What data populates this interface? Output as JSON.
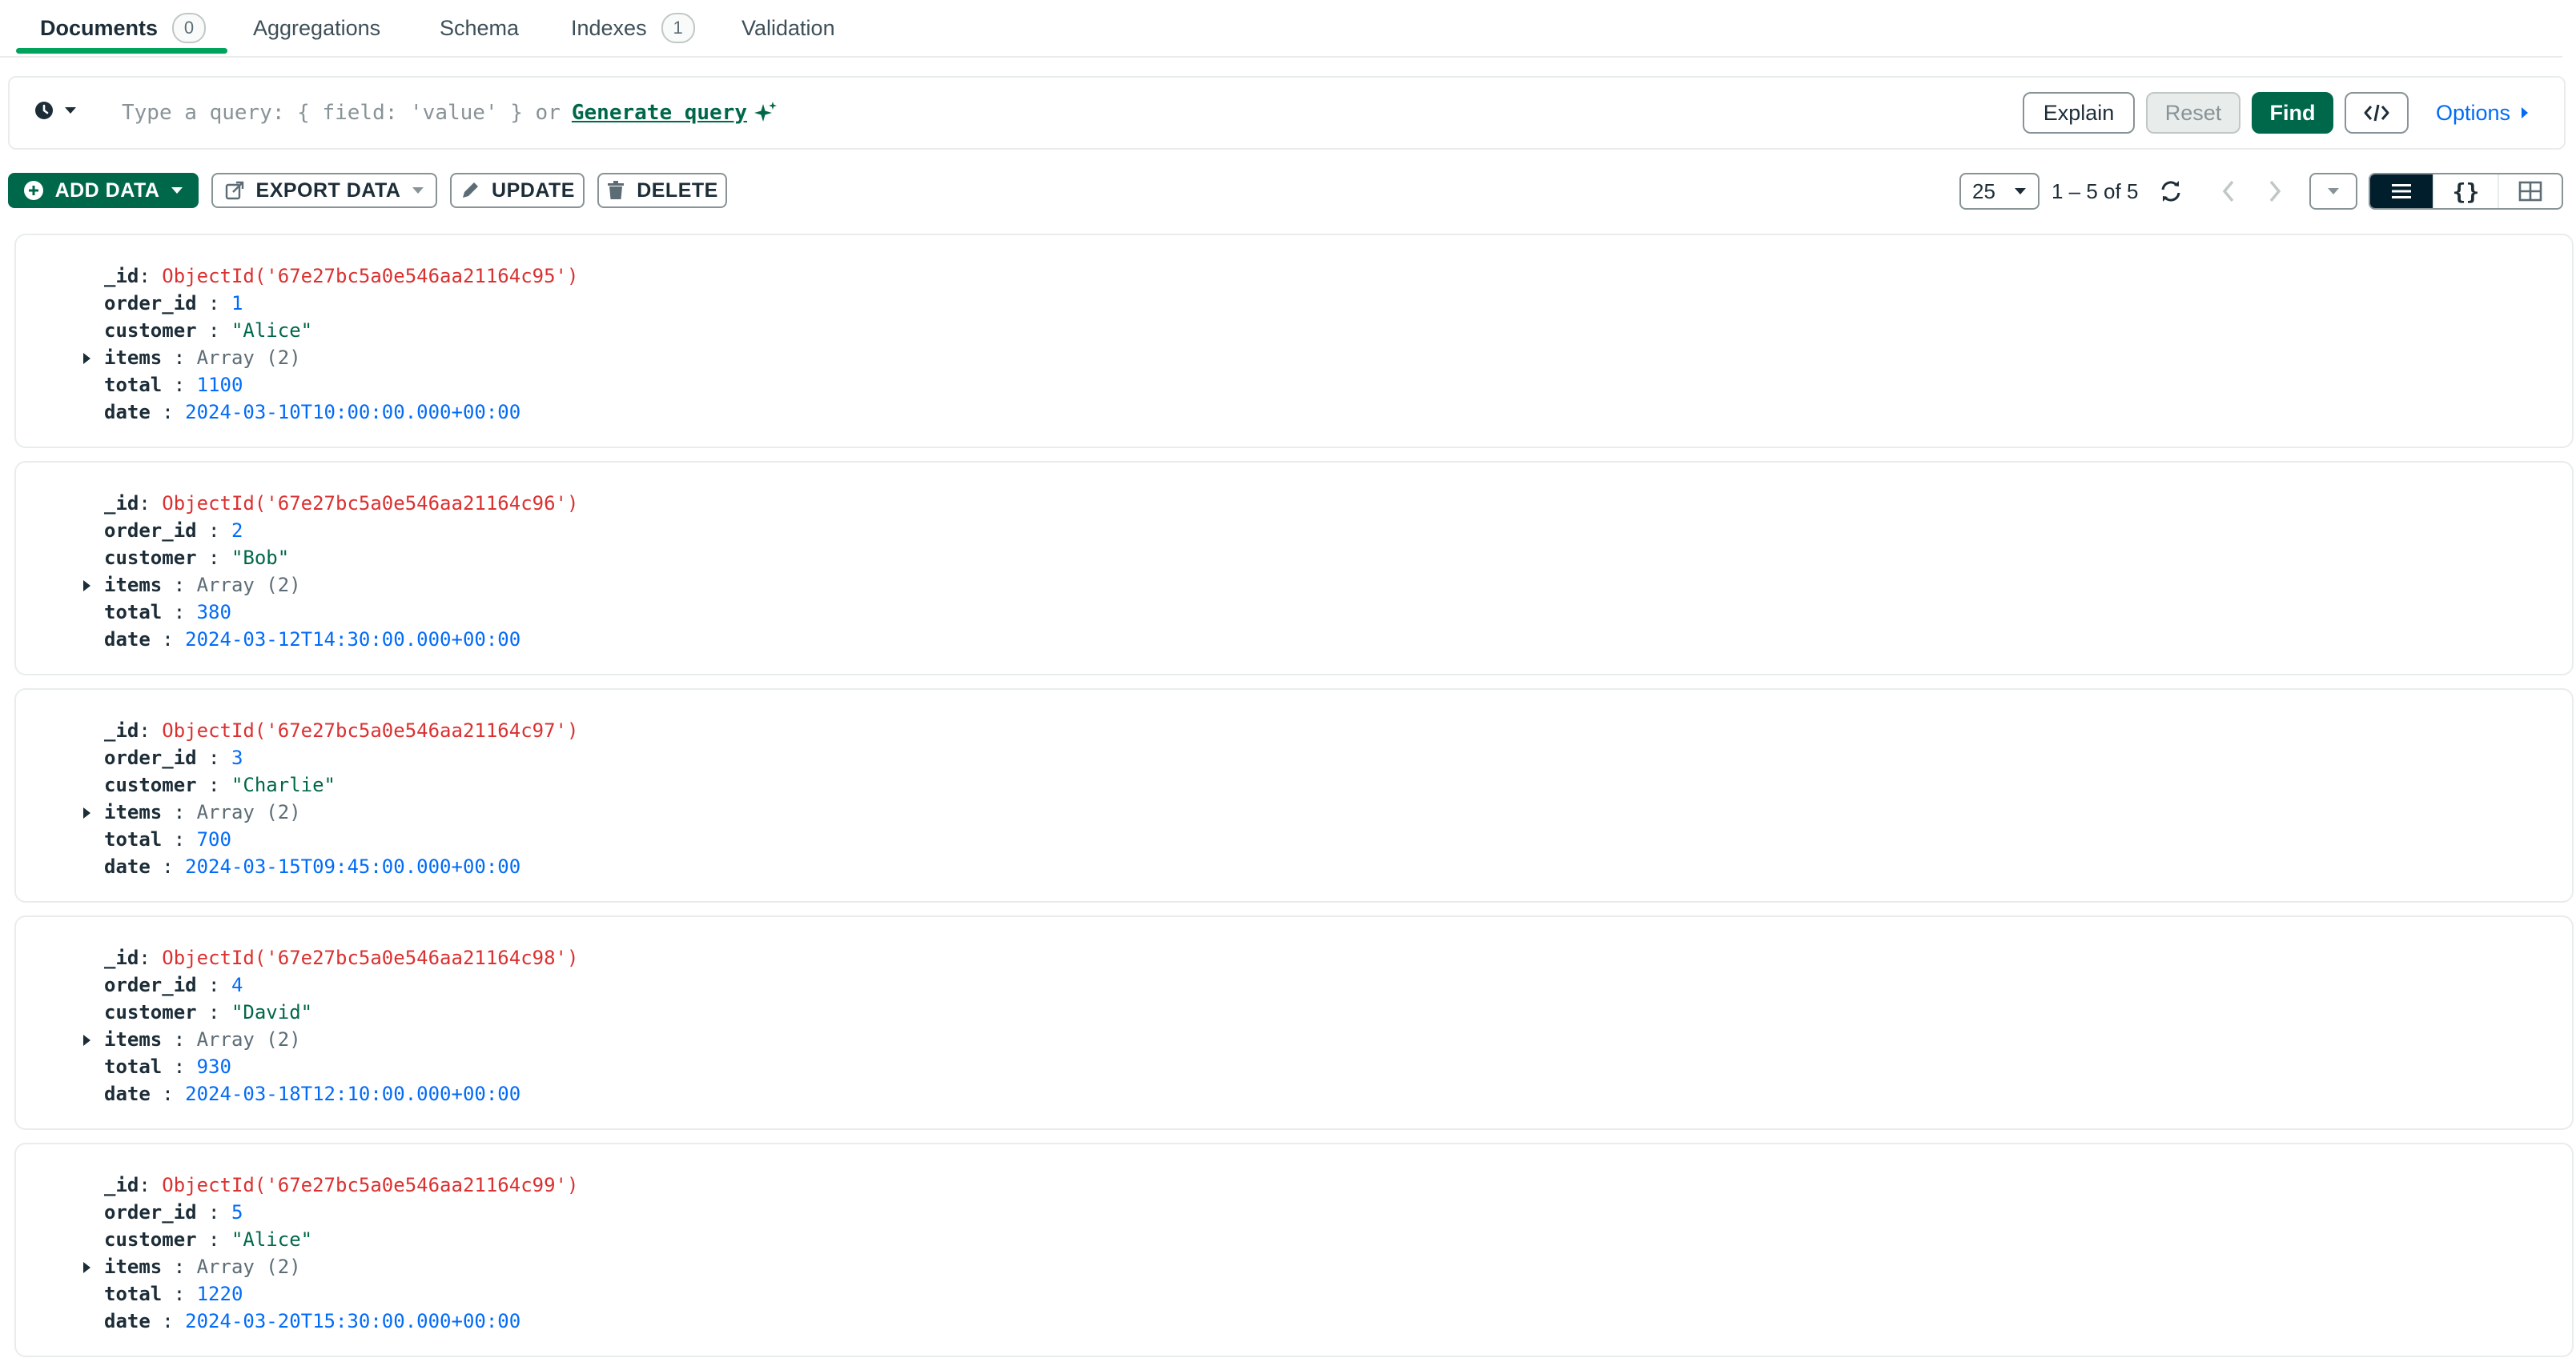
{
  "tabs": [
    {
      "label": "Documents",
      "count": "0"
    },
    {
      "label": "Aggregations"
    },
    {
      "label": "Schema"
    },
    {
      "label": "Indexes",
      "count": "1"
    },
    {
      "label": "Validation"
    }
  ],
  "query": {
    "placeholder": "Type a query: { field: 'value' } or",
    "generate_label": "Generate query",
    "explain_label": "Explain",
    "reset_label": "Reset",
    "find_label": "Find",
    "options_label": "Options"
  },
  "toolbar": {
    "add_data": "ADD DATA",
    "export_data": "EXPORT DATA",
    "update": "UPDATE",
    "delete": "DELETE",
    "page_size": "25",
    "range": "1 – 5 of 5"
  },
  "documents": [
    {
      "_id": "ObjectId('67e27bc5a0e546aa21164c95')",
      "order_id": "1",
      "customer": "\"Alice\"",
      "items": "Array (2)",
      "total": "1100",
      "date": "2024-03-10T10:00:00.000+00:00"
    },
    {
      "_id": "ObjectId('67e27bc5a0e546aa21164c96')",
      "order_id": "2",
      "customer": "\"Bob\"",
      "items": "Array (2)",
      "total": "380",
      "date": "2024-03-12T14:30:00.000+00:00"
    },
    {
      "_id": "ObjectId('67e27bc5a0e546aa21164c97')",
      "order_id": "3",
      "customer": "\"Charlie\"",
      "items": "Array (2)",
      "total": "700",
      "date": "2024-03-15T09:45:00.000+00:00"
    },
    {
      "_id": "ObjectId('67e27bc5a0e546aa21164c98')",
      "order_id": "4",
      "customer": "\"David\"",
      "items": "Array (2)",
      "total": "930",
      "date": "2024-03-18T12:10:00.000+00:00"
    },
    {
      "_id": "ObjectId('67e27bc5a0e546aa21164c99')",
      "order_id": "5",
      "customer": "\"Alice\"",
      "items": "Array (2)",
      "total": "1220",
      "date": "2024-03-20T15:30:00.000+00:00"
    }
  ],
  "field_keys": {
    "_id": "_id",
    "order_id": "order_id",
    "customer": "customer",
    "items": "items",
    "total": "total",
    "date": "date"
  },
  "colors": {
    "accent": "#00684a",
    "tab_active": "#00a35c",
    "link": "#016bf8",
    "objectid": "#db3030"
  },
  "icons": {
    "history": "clock-icon",
    "generate": "sparkle-icon",
    "code": "code-icon",
    "refresh": "refresh-icon",
    "list_view": "list-icon",
    "json_view": "braces-icon",
    "table_view": "table-icon"
  }
}
